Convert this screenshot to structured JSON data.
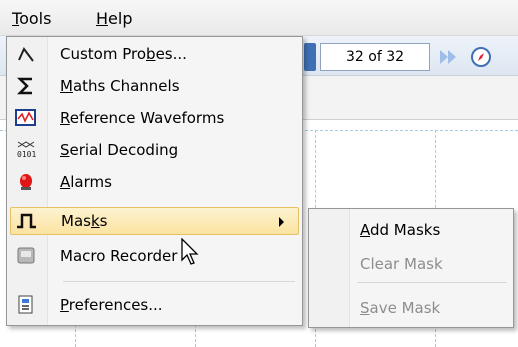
{
  "menubar": {
    "items": [
      {
        "label_u": "T",
        "label_rest": "ools"
      },
      {
        "label_u": "H",
        "label_rest": "elp"
      }
    ]
  },
  "toolbar": {
    "page_counter": "32 of 32",
    "icons": [
      "next-page-icon",
      "compass-icon"
    ]
  },
  "tools_menu": {
    "items": [
      {
        "pre": "Custom Pro",
        "u": "b",
        "post": "es...",
        "icon": "probe-icon"
      },
      {
        "pre": "",
        "u": "M",
        "post": "aths Channels",
        "icon": "sigma-icon"
      },
      {
        "pre": "",
        "u": "R",
        "post": "eference Waveforms",
        "icon": "waveform-icon"
      },
      {
        "pre": "",
        "u": "S",
        "post": "erial Decoding",
        "icon": "serial-icon"
      },
      {
        "pre": "",
        "u": "A",
        "post": "larms",
        "icon": "alarm-icon"
      },
      {
        "pre": "Mas",
        "u": "k",
        "post": "s",
        "icon": "mask-icon",
        "highlighted": true,
        "submenu": true
      },
      {
        "pre": "Macro Recorder",
        "u": "",
        "post": "",
        "icon": "macro-icon"
      },
      {
        "pre": "",
        "u": "P",
        "post": "references...",
        "icon": "preferences-icon"
      }
    ],
    "serial_icon_text": "0101"
  },
  "masks_submenu": {
    "items": [
      {
        "u": "A",
        "rest": "dd Masks",
        "enabled": true
      },
      {
        "u": "",
        "rest": "Clear Mask",
        "enabled": false
      },
      {
        "u": "S",
        "rest": "ave Mask",
        "enabled": false
      }
    ]
  },
  "colors": {
    "highlight_top": "#fdf3d1",
    "highlight_bottom": "#fbe3a0",
    "grid": "#a9c9df",
    "toolbar_blue": "#3f6fb4"
  }
}
